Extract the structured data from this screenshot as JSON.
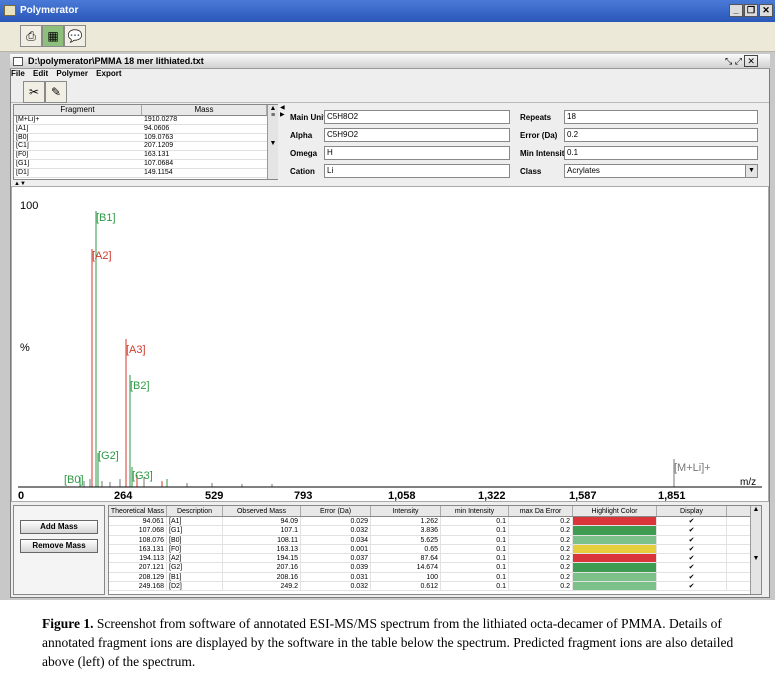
{
  "app": {
    "title": "Polymerator",
    "window_buttons": [
      "_",
      "❐",
      "✕"
    ]
  },
  "document": {
    "title": "D:\\polymerator\\PMMA 18 mer lithiated.txt",
    "menu": [
      "File",
      "Edit",
      "Polymer",
      "Export"
    ]
  },
  "fragments": {
    "headers": [
      "Fragment",
      "Mass"
    ],
    "rows": [
      {
        "fragment": "[M+Li]+",
        "mass": "1910.0278"
      },
      {
        "fragment": "[A1]",
        "mass": "94.0606"
      },
      {
        "fragment": "[B0]",
        "mass": "109.0763"
      },
      {
        "fragment": "[C1]",
        "mass": "207.1209"
      },
      {
        "fragment": "[F0]",
        "mass": "163.131"
      },
      {
        "fragment": "[G1]",
        "mass": "107.0684"
      },
      {
        "fragment": "[D1]",
        "mass": "149.1154"
      }
    ]
  },
  "form": {
    "main_unit_label": "Main Unit",
    "main_unit": "C5H8O2",
    "alpha_label": "Alpha",
    "alpha": "C5H9O2",
    "omega_label": "Omega",
    "omega": "H",
    "cation_label": "Cation",
    "cation": "Li",
    "repeats_label": "Repeats",
    "repeats": "18",
    "error_label": "Error (Da)",
    "error": "0.2",
    "min_intensity_label": "Min Intensity",
    "min_intensity": "0.1",
    "class_label": "Class",
    "class": "Acrylates"
  },
  "spectrum": {
    "y_top_label": "100",
    "y_mid_label": "%",
    "x_unit": "m/z",
    "x_ticks": [
      "0",
      "264",
      "529",
      "793",
      "1,058",
      "1,322",
      "1,587",
      "1,851"
    ],
    "peaks_label_colors": {
      "green": "#2e9a45",
      "red": "#d0392b",
      "gray": "#777777"
    },
    "annotations": [
      {
        "label": "[B1]",
        "color": "green"
      },
      {
        "label": "[A2]",
        "color": "red"
      },
      {
        "label": "[A3]",
        "color": "red"
      },
      {
        "label": "[B2]",
        "color": "green"
      },
      {
        "label": "[G2]",
        "color": "green"
      },
      {
        "label": "[G3]",
        "color": "green"
      },
      {
        "label": "[B0]",
        "color": "green"
      },
      {
        "label": "[M+Li]+",
        "color": "gray"
      }
    ]
  },
  "buttons": {
    "add_mass": "Add Mass",
    "remove_mass": "Remove Mass"
  },
  "results": {
    "headers": [
      "Theoretical Mass",
      "Description",
      "Observed Mass",
      "Error (Da)",
      "Intensity",
      "min Intensity",
      "max Da Error",
      "Highlight Color",
      "Display"
    ],
    "rows": [
      {
        "theo": "94.061",
        "desc": "[A1]",
        "obs": "94.09",
        "err": "0.029",
        "int": "1.262",
        "minint": "0.1",
        "maxerr": "0.2",
        "color": "#d9353a",
        "display": "✔"
      },
      {
        "theo": "107.068",
        "desc": "[G1]",
        "obs": "107.1",
        "err": "0.032",
        "int": "3.836",
        "minint": "0.1",
        "maxerr": "0.2",
        "color": "#3e9c52",
        "display": "✔"
      },
      {
        "theo": "108.076",
        "desc": "[B0]",
        "obs": "108.11",
        "err": "0.034",
        "int": "5.625",
        "minint": "0.1",
        "maxerr": "0.2",
        "color": "#7cc08a",
        "display": "✔"
      },
      {
        "theo": "163.131",
        "desc": "[F0]",
        "obs": "163.13",
        "err": "0.001",
        "int": "0.65",
        "minint": "0.1",
        "maxerr": "0.2",
        "color": "#e6cf3c",
        "display": "✔"
      },
      {
        "theo": "194.113",
        "desc": "[A2]",
        "obs": "194.15",
        "err": "0.037",
        "int": "87.64",
        "minint": "0.1",
        "maxerr": "0.2",
        "color": "#d9353a",
        "display": "✔"
      },
      {
        "theo": "207.121",
        "desc": "[G2]",
        "obs": "207.16",
        "err": "0.039",
        "int": "14.674",
        "minint": "0.1",
        "maxerr": "0.2",
        "color": "#3e9c52",
        "display": "✔"
      },
      {
        "theo": "208.129",
        "desc": "[B1]",
        "obs": "208.16",
        "err": "0.031",
        "int": "100",
        "minint": "0.1",
        "maxerr": "0.2",
        "color": "#7cc08a",
        "display": "✔"
      },
      {
        "theo": "249.168",
        "desc": "[D2]",
        "obs": "249.2",
        "err": "0.032",
        "int": "0.612",
        "minint": "0.1",
        "maxerr": "0.2",
        "color": "#7cc08a",
        "display": "✔"
      }
    ]
  },
  "caption": {
    "label": "Figure 1.",
    "text": "Screenshot from software of annotated ESI-MS/MS spectrum from the lithiated octa-decamer of PMMA. Details of annotated fragment ions are displayed by the software in the table below the spectrum. Predicted fragment ions are also detailed above (left) of the spectrum."
  }
}
